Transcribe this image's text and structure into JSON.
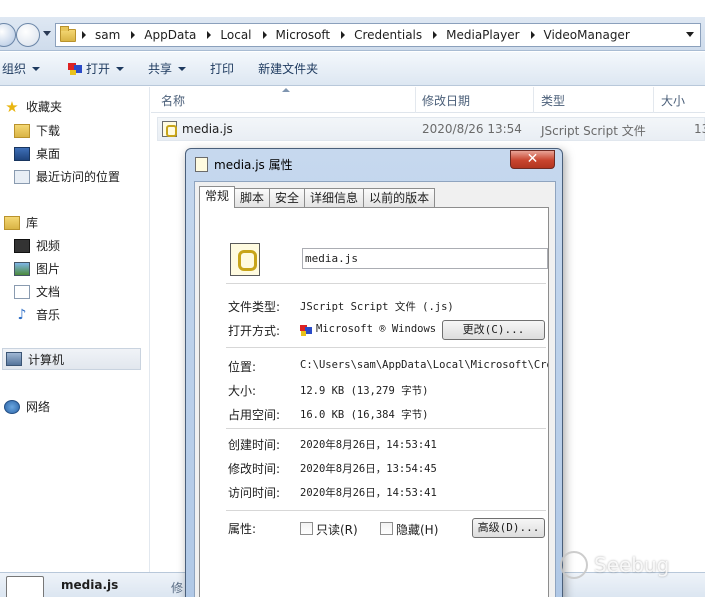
{
  "address_bar": {
    "crumbs": [
      "sam",
      "AppData",
      "Local",
      "Microsoft",
      "Credentials",
      "MediaPlayer",
      "VideoManager"
    ]
  },
  "toolbar": {
    "organize": "组织",
    "open": "打开",
    "share": "共享",
    "print": "打印",
    "new_folder": "新建文件夹"
  },
  "nav_pane": {
    "favorites": "收藏夹",
    "downloads": "下载",
    "desktop": "桌面",
    "recent": "最近访问的位置",
    "libraries": "库",
    "videos": "视频",
    "pictures": "图片",
    "documents": "文档",
    "music": "音乐",
    "computer": "计算机",
    "network": "网络"
  },
  "columns": {
    "name": "名称",
    "modified": "修改日期",
    "type": "类型",
    "size": "大小"
  },
  "file": {
    "name": "media.js",
    "modified": "2020/8/26 13:54",
    "type": "JScript Script 文件",
    "size_partial": "13"
  },
  "details_bar": {
    "name": "media.js",
    "modified_label_partial": "修"
  },
  "dialog": {
    "title": "media.js 属性",
    "close_glyph": "✕",
    "tabs": [
      "常规",
      "脚本",
      "安全",
      "详细信息",
      "以前的版本"
    ],
    "file_name": "media.js",
    "labels": {
      "type": "文件类型:",
      "opens_with": "打开方式:",
      "location": "位置:",
      "size": "大小:",
      "size_on_disk": "占用空间:",
      "created": "创建时间:",
      "modified": "修改时间:",
      "accessed": "访问时间:",
      "attributes": "属性:"
    },
    "values": {
      "type": "JScript Script 文件 (.js)",
      "opens_with": "Microsoft ® Windows Based Script Host",
      "location": "C:\\Users\\sam\\AppData\\Local\\Microsoft\\Credentials\\MediaPlayer\\VideoManager",
      "size": "12.9 KB (13,279 字节)",
      "size_on_disk": "16.0 KB (16,384 字节)",
      "created": "2020年8月26日，14:53:41",
      "modified": "2020年8月26日，13:54:45",
      "accessed": "2020年8月26日，14:53:41"
    },
    "change_button": "更改(C)...",
    "readonly_label": "只读(R)",
    "hidden_label": "隐藏(H)",
    "advanced_button": "高级(D)..."
  },
  "watermark": "Seebug"
}
